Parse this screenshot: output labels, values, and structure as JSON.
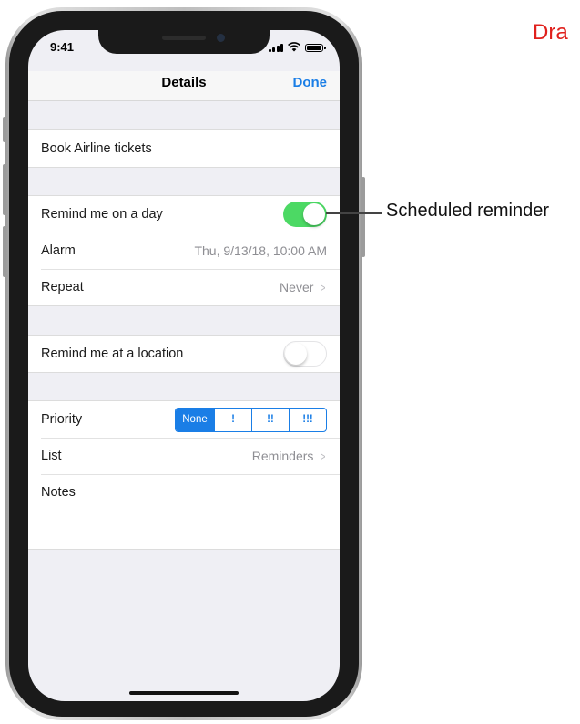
{
  "corner_label": "Dra",
  "status_bar": {
    "time": "9:41"
  },
  "nav": {
    "title": "Details",
    "done_label": "Done"
  },
  "task": {
    "title": "Book Airline tickets"
  },
  "schedule": {
    "remind_day_label": "Remind me on a day",
    "remind_day_on": true,
    "alarm_label": "Alarm",
    "alarm_value": "Thu, 9/13/18, 10:00 AM",
    "repeat_label": "Repeat",
    "repeat_value": "Never"
  },
  "location": {
    "remind_location_label": "Remind me at a location",
    "remind_location_on": false
  },
  "details": {
    "priority_label": "Priority",
    "priority_options": [
      "None",
      "!",
      "!!",
      "!!!"
    ],
    "priority_selected": "None",
    "list_label": "List",
    "list_value": "Reminders",
    "notes_label": "Notes"
  },
  "callout": {
    "text": "Scheduled reminder"
  },
  "colors": {
    "accent": "#1a7ee6",
    "toggle_on": "#4cd964",
    "callout_red": "#e0201c"
  },
  "icons": [
    "signal-icon",
    "wifi-icon",
    "battery-icon",
    "chevron-right-icon"
  ]
}
